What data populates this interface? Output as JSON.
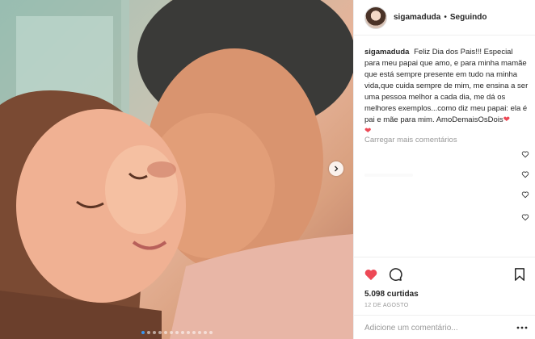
{
  "header": {
    "username": "sigamaduda",
    "separator": "•",
    "follow_status": "Seguindo"
  },
  "caption": {
    "username": "sigamaduda",
    "text": "Feliz Dia dos Pais!!! Especial para meu papai que amo, e para minha mamãe que está sempre presente em tudo na minha vida,que cuida sempre de mim, me ensina a ser uma pessoa melhor a cada dia, me dá os melhores exemplos...como diz meu papai: ela é pai e mãe para mim. AmoDemaisOsDois",
    "emoji": "❤",
    "trailing_emoji": "❤"
  },
  "comments": {
    "load_more": "Carregar mais comentários"
  },
  "actions": {
    "like_icon": "heart-filled-icon",
    "comment_icon": "comment-bubble-icon",
    "save_icon": "bookmark-icon",
    "like_color": "#ed4956"
  },
  "stats": {
    "likes": "5.098 curtidas",
    "date": "12 DE AGOSTO"
  },
  "add_comment": {
    "placeholder": "Adicione um comentário...",
    "more_icon": "more-options-icon"
  },
  "carousel": {
    "next_icon": "chevron-right-icon",
    "current_slide": 1,
    "slide_count": 13
  }
}
